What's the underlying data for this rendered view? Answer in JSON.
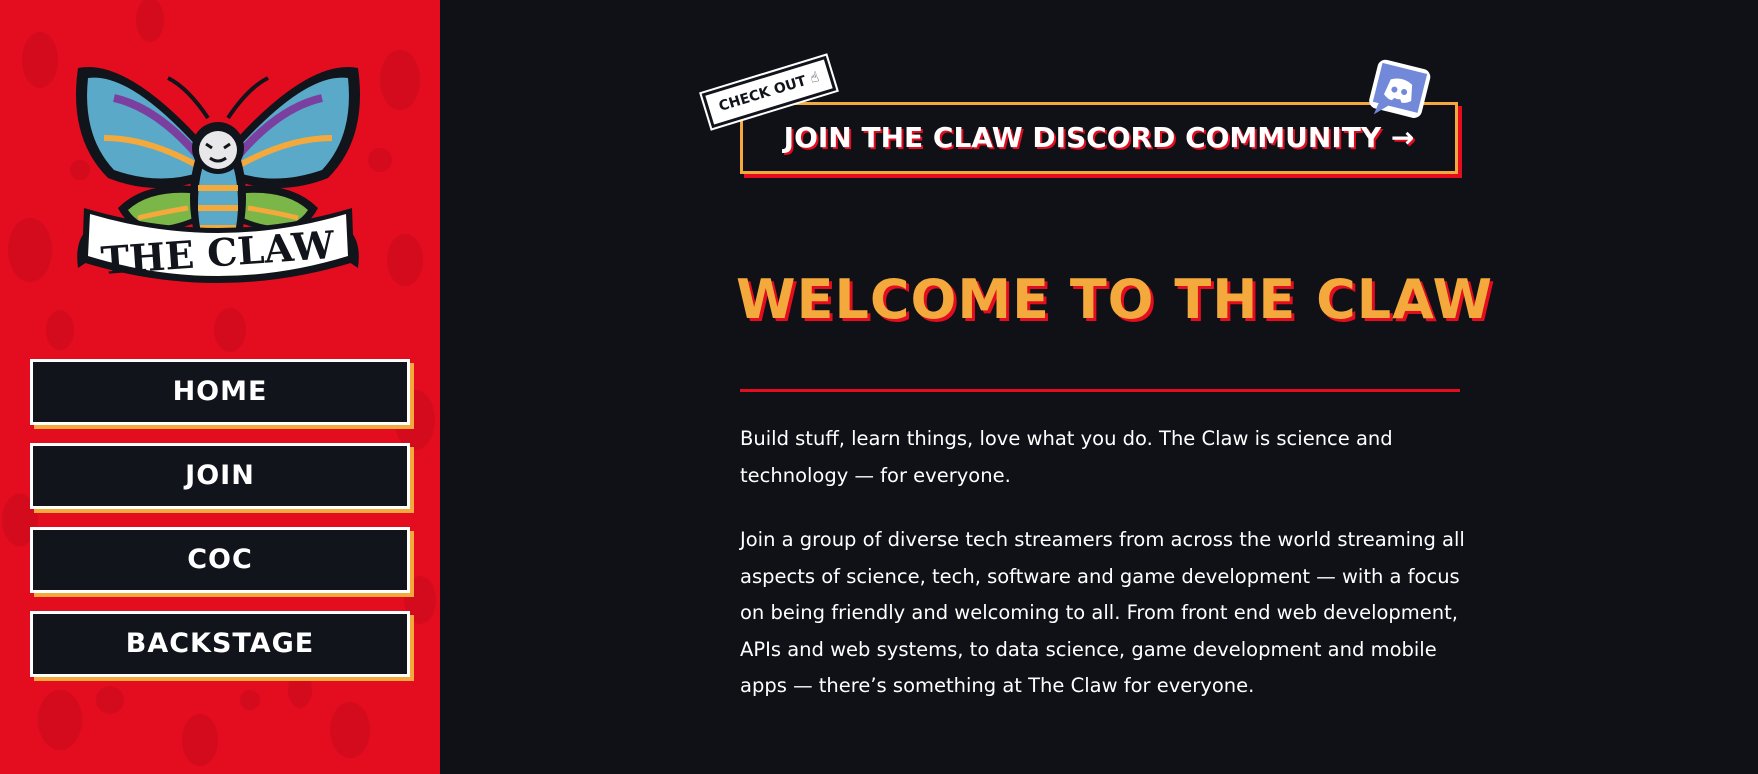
{
  "logo": {
    "text": "THE CLAW",
    "icon": "moth-logo"
  },
  "nav": {
    "items": [
      {
        "label": "HOME"
      },
      {
        "label": "JOIN"
      },
      {
        "label": "COC"
      },
      {
        "label": "BACKSTAGE"
      }
    ]
  },
  "promo": {
    "badge": "CHECK OUT ☝",
    "label": "JOIN THE CLAW DISCORD COMMUNITY →",
    "icon": "discord-icon"
  },
  "main": {
    "title": "WELCOME TO THE CLAW",
    "paragraphs": [
      "Build stuff, learn things, love what you do. The Claw is science and technology — for everyone.",
      "Join a group of diverse tech streamers from across the world streaming all aspects of science, tech, software and game development — with a focus on being friendly and welcoming to all. From front end web development, APIs and web systems, to data science, game development and mobile apps — there’s something at The Claw for everyone."
    ]
  },
  "colors": {
    "sidebar_bg": "#e30d1f",
    "page_bg": "#0f1117",
    "accent_orange": "#f4a93c",
    "accent_red": "#e30d1f",
    "discord_blue": "#7289da"
  }
}
